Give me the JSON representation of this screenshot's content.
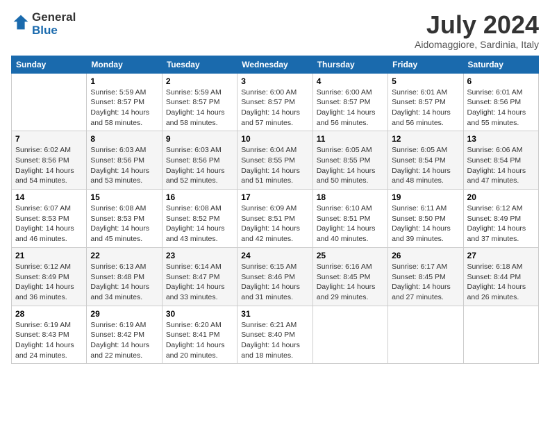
{
  "logo": {
    "general": "General",
    "blue": "Blue"
  },
  "title": "July 2024",
  "subtitle": "Aidomaggiore, Sardinia, Italy",
  "header_days": [
    "Sunday",
    "Monday",
    "Tuesday",
    "Wednesday",
    "Thursday",
    "Friday",
    "Saturday"
  ],
  "weeks": [
    [
      {
        "day": "",
        "sunrise": "",
        "sunset": "",
        "daylight": ""
      },
      {
        "day": "1",
        "sunrise": "Sunrise: 5:59 AM",
        "sunset": "Sunset: 8:57 PM",
        "daylight": "Daylight: 14 hours and 58 minutes."
      },
      {
        "day": "2",
        "sunrise": "Sunrise: 5:59 AM",
        "sunset": "Sunset: 8:57 PM",
        "daylight": "Daylight: 14 hours and 58 minutes."
      },
      {
        "day": "3",
        "sunrise": "Sunrise: 6:00 AM",
        "sunset": "Sunset: 8:57 PM",
        "daylight": "Daylight: 14 hours and 57 minutes."
      },
      {
        "day": "4",
        "sunrise": "Sunrise: 6:00 AM",
        "sunset": "Sunset: 8:57 PM",
        "daylight": "Daylight: 14 hours and 56 minutes."
      },
      {
        "day": "5",
        "sunrise": "Sunrise: 6:01 AM",
        "sunset": "Sunset: 8:57 PM",
        "daylight": "Daylight: 14 hours and 56 minutes."
      },
      {
        "day": "6",
        "sunrise": "Sunrise: 6:01 AM",
        "sunset": "Sunset: 8:56 PM",
        "daylight": "Daylight: 14 hours and 55 minutes."
      }
    ],
    [
      {
        "day": "7",
        "sunrise": "Sunrise: 6:02 AM",
        "sunset": "Sunset: 8:56 PM",
        "daylight": "Daylight: 14 hours and 54 minutes."
      },
      {
        "day": "8",
        "sunrise": "Sunrise: 6:03 AM",
        "sunset": "Sunset: 8:56 PM",
        "daylight": "Daylight: 14 hours and 53 minutes."
      },
      {
        "day": "9",
        "sunrise": "Sunrise: 6:03 AM",
        "sunset": "Sunset: 8:56 PM",
        "daylight": "Daylight: 14 hours and 52 minutes."
      },
      {
        "day": "10",
        "sunrise": "Sunrise: 6:04 AM",
        "sunset": "Sunset: 8:55 PM",
        "daylight": "Daylight: 14 hours and 51 minutes."
      },
      {
        "day": "11",
        "sunrise": "Sunrise: 6:05 AM",
        "sunset": "Sunset: 8:55 PM",
        "daylight": "Daylight: 14 hours and 50 minutes."
      },
      {
        "day": "12",
        "sunrise": "Sunrise: 6:05 AM",
        "sunset": "Sunset: 8:54 PM",
        "daylight": "Daylight: 14 hours and 48 minutes."
      },
      {
        "day": "13",
        "sunrise": "Sunrise: 6:06 AM",
        "sunset": "Sunset: 8:54 PM",
        "daylight": "Daylight: 14 hours and 47 minutes."
      }
    ],
    [
      {
        "day": "14",
        "sunrise": "Sunrise: 6:07 AM",
        "sunset": "Sunset: 8:53 PM",
        "daylight": "Daylight: 14 hours and 46 minutes."
      },
      {
        "day": "15",
        "sunrise": "Sunrise: 6:08 AM",
        "sunset": "Sunset: 8:53 PM",
        "daylight": "Daylight: 14 hours and 45 minutes."
      },
      {
        "day": "16",
        "sunrise": "Sunrise: 6:08 AM",
        "sunset": "Sunset: 8:52 PM",
        "daylight": "Daylight: 14 hours and 43 minutes."
      },
      {
        "day": "17",
        "sunrise": "Sunrise: 6:09 AM",
        "sunset": "Sunset: 8:51 PM",
        "daylight": "Daylight: 14 hours and 42 minutes."
      },
      {
        "day": "18",
        "sunrise": "Sunrise: 6:10 AM",
        "sunset": "Sunset: 8:51 PM",
        "daylight": "Daylight: 14 hours and 40 minutes."
      },
      {
        "day": "19",
        "sunrise": "Sunrise: 6:11 AM",
        "sunset": "Sunset: 8:50 PM",
        "daylight": "Daylight: 14 hours and 39 minutes."
      },
      {
        "day": "20",
        "sunrise": "Sunrise: 6:12 AM",
        "sunset": "Sunset: 8:49 PM",
        "daylight": "Daylight: 14 hours and 37 minutes."
      }
    ],
    [
      {
        "day": "21",
        "sunrise": "Sunrise: 6:12 AM",
        "sunset": "Sunset: 8:49 PM",
        "daylight": "Daylight: 14 hours and 36 minutes."
      },
      {
        "day": "22",
        "sunrise": "Sunrise: 6:13 AM",
        "sunset": "Sunset: 8:48 PM",
        "daylight": "Daylight: 14 hours and 34 minutes."
      },
      {
        "day": "23",
        "sunrise": "Sunrise: 6:14 AM",
        "sunset": "Sunset: 8:47 PM",
        "daylight": "Daylight: 14 hours and 33 minutes."
      },
      {
        "day": "24",
        "sunrise": "Sunrise: 6:15 AM",
        "sunset": "Sunset: 8:46 PM",
        "daylight": "Daylight: 14 hours and 31 minutes."
      },
      {
        "day": "25",
        "sunrise": "Sunrise: 6:16 AM",
        "sunset": "Sunset: 8:45 PM",
        "daylight": "Daylight: 14 hours and 29 minutes."
      },
      {
        "day": "26",
        "sunrise": "Sunrise: 6:17 AM",
        "sunset": "Sunset: 8:45 PM",
        "daylight": "Daylight: 14 hours and 27 minutes."
      },
      {
        "day": "27",
        "sunrise": "Sunrise: 6:18 AM",
        "sunset": "Sunset: 8:44 PM",
        "daylight": "Daylight: 14 hours and 26 minutes."
      }
    ],
    [
      {
        "day": "28",
        "sunrise": "Sunrise: 6:19 AM",
        "sunset": "Sunset: 8:43 PM",
        "daylight": "Daylight: 14 hours and 24 minutes."
      },
      {
        "day": "29",
        "sunrise": "Sunrise: 6:19 AM",
        "sunset": "Sunset: 8:42 PM",
        "daylight": "Daylight: 14 hours and 22 minutes."
      },
      {
        "day": "30",
        "sunrise": "Sunrise: 6:20 AM",
        "sunset": "Sunset: 8:41 PM",
        "daylight": "Daylight: 14 hours and 20 minutes."
      },
      {
        "day": "31",
        "sunrise": "Sunrise: 6:21 AM",
        "sunset": "Sunset: 8:40 PM",
        "daylight": "Daylight: 14 hours and 18 minutes."
      },
      {
        "day": "",
        "sunrise": "",
        "sunset": "",
        "daylight": ""
      },
      {
        "day": "",
        "sunrise": "",
        "sunset": "",
        "daylight": ""
      },
      {
        "day": "",
        "sunrise": "",
        "sunset": "",
        "daylight": ""
      }
    ]
  ]
}
